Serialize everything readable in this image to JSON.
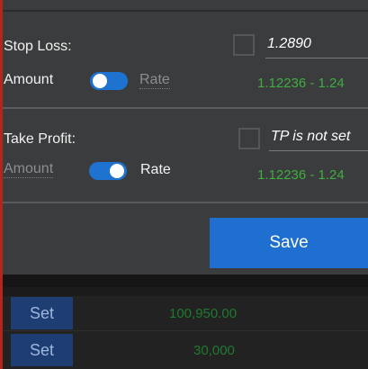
{
  "stop_loss": {
    "title": "Stop Loss:",
    "amount_label": "Amount",
    "rate_label": "Rate",
    "value": "1.2890",
    "range": "1.12236 - 1.24"
  },
  "take_profit": {
    "title": "Take Profit:",
    "amount_label": "Amount",
    "rate_label": "Rate",
    "placeholder": "TP is not set",
    "range": "1.12236 - 1.24"
  },
  "save_label": "Save",
  "rows": [
    {
      "button": "Set",
      "value": "100,950.00"
    },
    {
      "button": "Set",
      "value": "30,000"
    }
  ],
  "colors": {
    "accent": "#1f6fd1",
    "range_text": "#3fae3f",
    "panel_bg": "#3b3c3e",
    "row_value": "#1f7a2e"
  }
}
